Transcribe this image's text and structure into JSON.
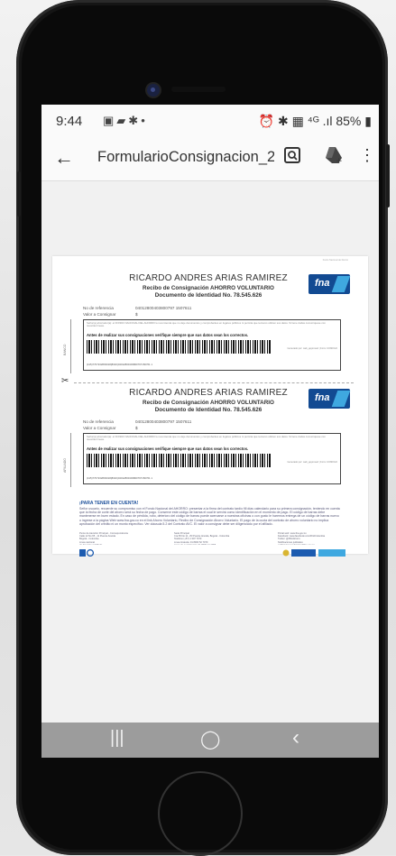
{
  "status_bar": {
    "time": "9:44",
    "left_icons": [
      "gallery-icon",
      "message-icon",
      "puzzle-icon",
      "dot-icon"
    ],
    "right_icons_text": "⏰ ✱ ▦ ⁴ᴳ .ıl",
    "battery": "85%"
  },
  "app_bar": {
    "back_icon": "arrow-left-icon",
    "title": "FormularioConsignacion_20...",
    "search_icon": "search-icon",
    "drive_icon": "drive-add-icon",
    "menu_icon": "more-vert-icon"
  },
  "document": {
    "slip1": {
      "name": "RICARDO ANDRES ARIAS RAMIREZ",
      "receipt": "Recibo de Consignación AHORRO VOLUNTARIO",
      "id_line": "Documento de Identidad No. 78.545.626",
      "ref_label": "No de referencia",
      "ref_value": "04012800403800797 1507611",
      "value_label": "Valor a Consignar",
      "value": "$",
      "section": "BANCO",
      "warning": "Antes de realizar sus consignaciones verifique siempre que sus datos sean los correctos.",
      "barcode_number": "(415)7707232803018(8020)04012800403800797150761 1",
      "generated": "Generado por: web_approved | Form CONFIGO",
      "fine_print": "Señor(a) ahorrador(a): el FONDO NACIONAL DEL AHORRO le recomienda que no deje documentos y comprobantes en lugares públicos ni permita que terceros utilicen sus datos. Si tiene dudas comuníquese con nuestras líneas."
    },
    "slip2": {
      "name": "RICARDO ANDRES ARIAS RAMIREZ",
      "receipt": "Recibo de Consignación AHORRO VOLUNTARIO",
      "id_line": "Documento de Identidad No. 78.545.626",
      "ref_label": "No de referencia",
      "ref_value": "04012800403800797 1507611",
      "value_label": "Valor a Consignar",
      "value": "$",
      "section": "AFILIADO",
      "warning": "Antes de realizar sus consignaciones verifique siempre que sus datos sean los correctos.",
      "barcode_number": "(415)7707232803018(8020)04012800403800797150761 1",
      "generated": "Generado por: web_approved | Form CONFIGO",
      "fine_print": "Señor(a) ahorrador(a): el FONDO NACIONAL DEL AHORRO le recomienda que no deje documentos y comprobantes en lugares públicos ni permita que terceros utilicen sus datos. Si tiene dudas comuníquese con nuestras líneas."
    },
    "logo_text": "fna",
    "watermark": "Fondo Nacional del Ahorro",
    "notice_title": "¡PARA TENER EN CUENTA!",
    "notice_text": "Señor usuario, recuerde su compromiso con el Fondo Nacional del AHORRO: presentar a la firma del contrato tardío fill días calendario para su primera consignación, teniendo en cuenta que la fecha de corte del ahorro será su fecha de pago. Conserve este código de barras el cual le servirá como identificación en el momento de pago. El código de barras debe mantenerse en buen estado. En caso de pérdida, robo, deterioro del código de barras puede acercarse a nuestras oficinas o con gusto le haremos entrega de un código de barras nuevo o ingrese a la página Web www.fna.gov.co en el link Ahorro Voluntario, Recibo de Consignación Ahorro Voluntario. El pago de la cuota del contrato de ahorro voluntario no implica aprobación del crédito ni un monto específico. Ver cláusula 5.2 del Contrato AVC. El valor a consignar debe ser diligenciado por el afiliado.",
    "footer_col1": "Punto de Atención Principal - Correspondencia\nCalle 12 No 65 - 11 Puente Aranda\nBogotá - Colombia\nLínea nacional\nde Atención al Afiliado",
    "footer_col2": "Sede Principal\nCra 65 No 11 - 83 Puente Aranda, Bogotá - Colombia\nTeléfono (+57) 1 307 7070\nLínea Gratuita: 01 8000 52 7070\nLínea de Legalización: 01 8000 12 2065",
    "footer_col3": "Portal web: www.fna.gov.co\nFacebook: www.facebook.com/FNAColombia\nTwitter: @FNAAhorro\nNotificaciones judiciales:\nnotificacionesjudiciales@fna.gov.co"
  },
  "nav_bar": {
    "recents": "|||",
    "home": "◯",
    "back": "‹"
  },
  "colors": {
    "brand": "#124a92",
    "accent": "#3fa8e0",
    "navbar": "#9c9c9c"
  }
}
